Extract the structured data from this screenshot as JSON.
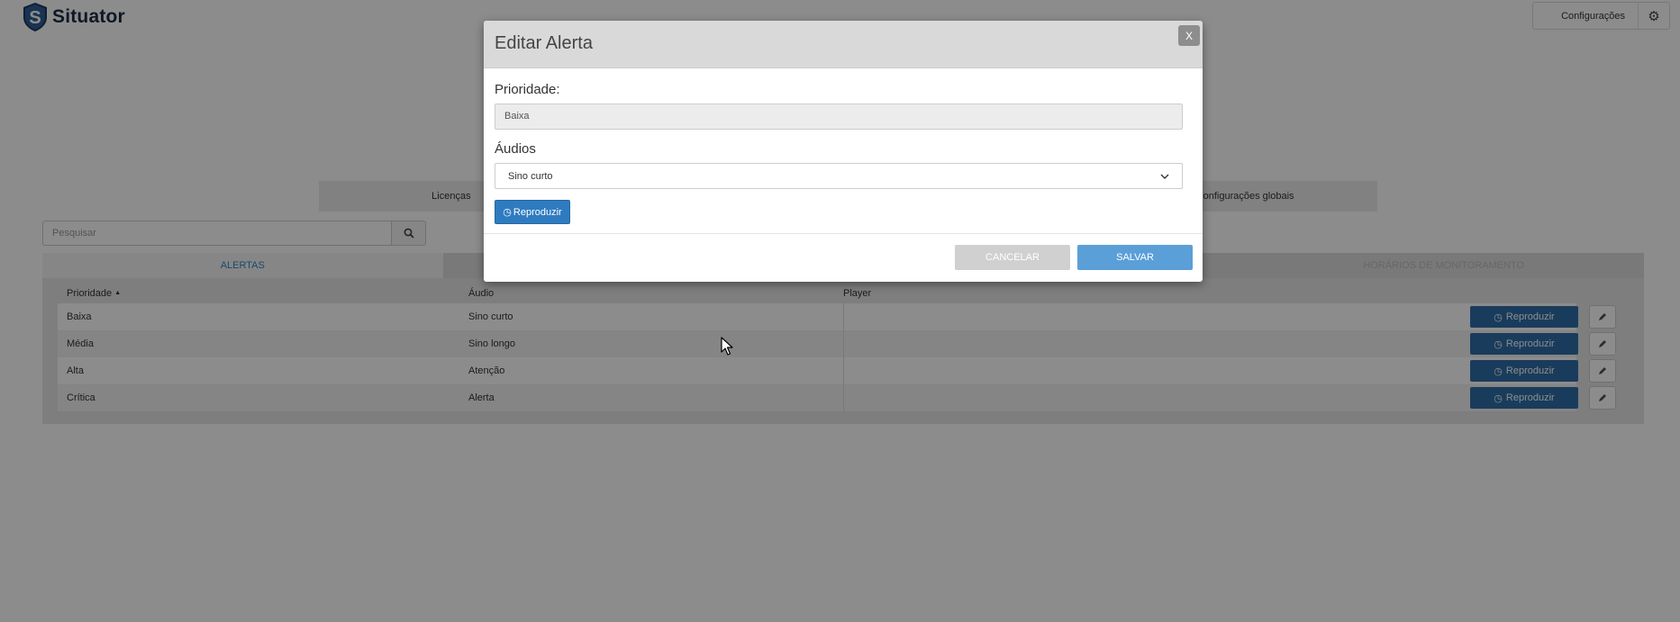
{
  "app": {
    "name": "Situator"
  },
  "header": {
    "config_label": "Configurações"
  },
  "topnav": {
    "items": [
      "Licenças",
      "",
      "",
      "Configurações globais"
    ]
  },
  "search": {
    "placeholder": "Pesquisar"
  },
  "tabs": [
    {
      "label": "ALERTAS",
      "active": true
    },
    {
      "label": "",
      "active": false
    },
    {
      "label": "",
      "active": false
    },
    {
      "label": "HORÁRIOS DE MONITORAMENTO",
      "active": false
    }
  ],
  "table": {
    "columns": [
      "Prioridade",
      "Áudio",
      "Player"
    ],
    "sort_indicator": "▲",
    "rows": [
      {
        "priority": "Baixa",
        "audio": "Sino curto",
        "play_label": "Reproduzir"
      },
      {
        "priority": "Média",
        "audio": "Sino longo",
        "play_label": "Reproduzir"
      },
      {
        "priority": "Alta",
        "audio": "Atenção",
        "play_label": "Reproduzir"
      },
      {
        "priority": "Crítica",
        "audio": "Alerta",
        "play_label": "Reproduzir"
      }
    ]
  },
  "modal": {
    "title": "Editar Alerta",
    "close_label": "X",
    "priority_label": "Prioridade:",
    "priority_value": "Baixa",
    "audio_label": "Áudios",
    "audio_selected": "Sino curto",
    "play_label": "Reproduzir",
    "cancel_label": "CANCELAR",
    "save_label": "SALVAR"
  },
  "colors": {
    "primary": "#2f6ea8",
    "tab_active_text": "#2b86c7",
    "save_button": "#5b9fd8",
    "cancel_button": "#d0d0d0"
  }
}
